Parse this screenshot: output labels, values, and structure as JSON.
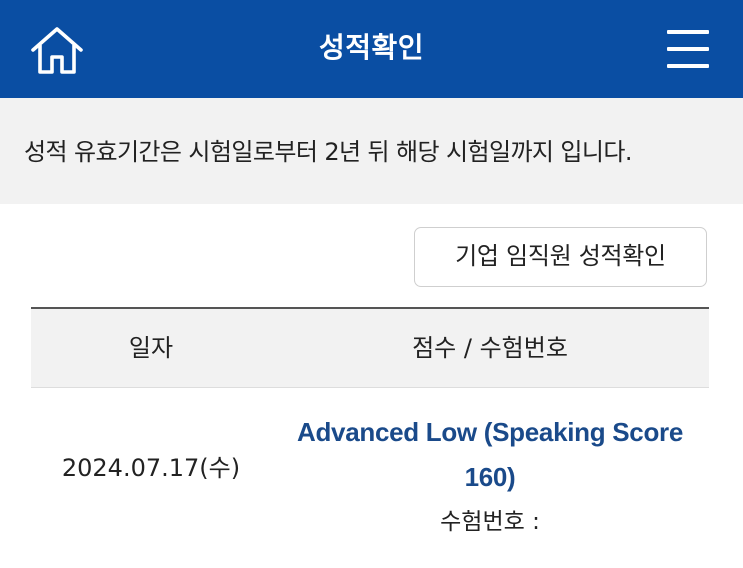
{
  "header": {
    "title": "성적확인",
    "home_icon": "home-icon",
    "menu_icon": "hamburger-menu-icon",
    "background_color": "#0a4ea3"
  },
  "notice": {
    "text": "성적 유효기간은 시험일로부터 2년 뒤 해당 시험일까지 입니다."
  },
  "corporate_button": {
    "label": "기업 임직원 성적확인"
  },
  "table": {
    "columns": [
      "일자",
      "점수 / 수험번호"
    ],
    "rows": [
      {
        "date": "2024.07.17(수)",
        "score_line1": "Advanced Low (Speaking Score",
        "score_line2": "160)",
        "exam_number_label": "수험번호 :"
      }
    ]
  },
  "colors": {
    "accent": "#0a4ea3",
    "score_link": "#1a4a8a"
  }
}
